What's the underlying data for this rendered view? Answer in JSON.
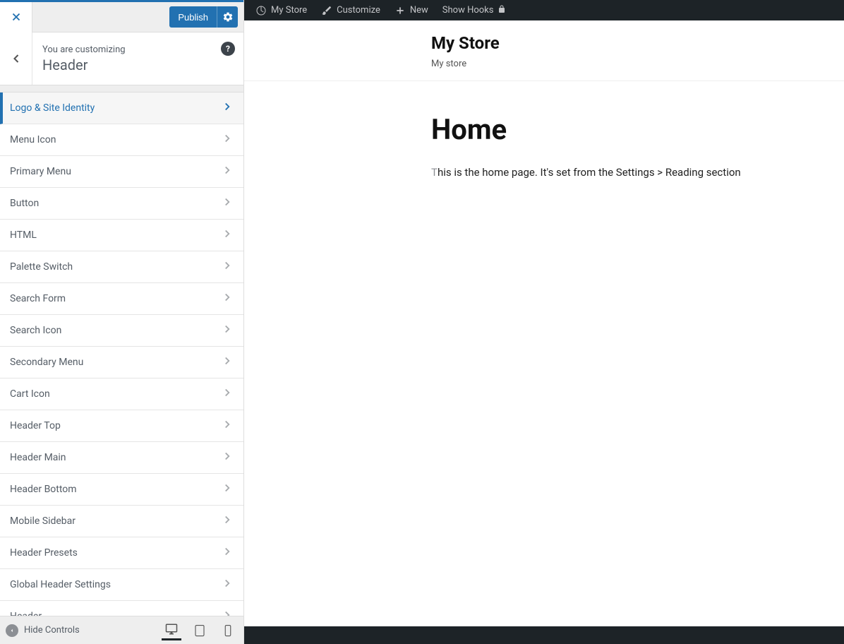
{
  "topbar": {
    "publish_label": "Publish"
  },
  "breadcrumb": {
    "label": "You are customizing",
    "title": "Header"
  },
  "menu_items": [
    {
      "label": "Logo & Site Identity",
      "active": true
    },
    {
      "label": "Menu Icon",
      "active": false
    },
    {
      "label": "Primary Menu",
      "active": false
    },
    {
      "label": "Button",
      "active": false
    },
    {
      "label": "HTML",
      "active": false
    },
    {
      "label": "Palette Switch",
      "active": false
    },
    {
      "label": "Search Form",
      "active": false
    },
    {
      "label": "Search Icon",
      "active": false
    },
    {
      "label": "Secondary Menu",
      "active": false
    },
    {
      "label": "Cart Icon",
      "active": false
    },
    {
      "label": "Header Top",
      "active": false
    },
    {
      "label": "Header Main",
      "active": false
    },
    {
      "label": "Header Bottom",
      "active": false
    },
    {
      "label": "Mobile Sidebar",
      "active": false
    },
    {
      "label": "Header Presets",
      "active": false
    },
    {
      "label": "Global Header Settings",
      "active": false
    },
    {
      "label": "Header",
      "active": false
    }
  ],
  "footer": {
    "hide_controls_label": "Hide Controls"
  },
  "admin_bar": {
    "site_name": "My Store",
    "customize": "Customize",
    "new": "New",
    "show_hooks": "Show Hooks"
  },
  "preview": {
    "site_title": "My Store",
    "site_tagline": "My store",
    "page_title": "Home",
    "page_body_first": "T",
    "page_body_rest": "his is the home page. It's set from the Settings > Reading section"
  }
}
